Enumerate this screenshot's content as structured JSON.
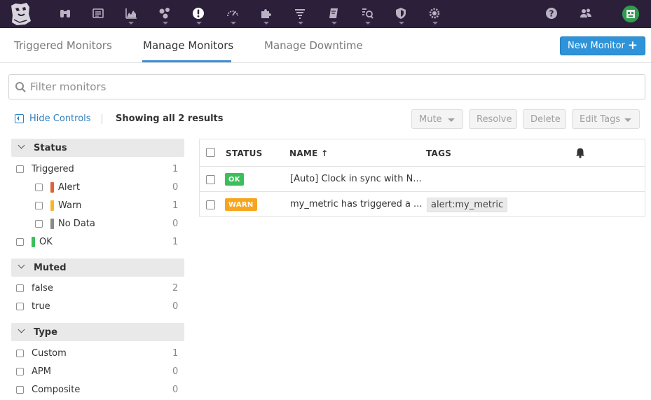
{
  "nav": {
    "icons": [
      "datadog-logo",
      "binoculars-icon",
      "list-icon",
      "area-chart-icon",
      "molecule-icon",
      "alert-icon",
      "dashboard-gauge-icon",
      "puzzle-icon",
      "filter-lines-icon",
      "notebook-icon",
      "apm-icon",
      "shield-icon",
      "gear-icon",
      "help-icon",
      "team-icon",
      "avatar"
    ]
  },
  "tabs": {
    "triggered": "Triggered Monitors",
    "manage": "Manage Monitors",
    "downtime": "Manage Downtime",
    "new_monitor": "New Monitor",
    "new_monitor_plus": "+"
  },
  "filter": {
    "placeholder": "Filter monitors"
  },
  "controls": {
    "hide_controls": "Hide Controls",
    "showing": "Showing all 2 results",
    "mute": "Mute",
    "resolve": "Resolve",
    "delete": "Delete",
    "edit_tags": "Edit Tags"
  },
  "sidebar": {
    "status": {
      "title": "Status",
      "triggered": {
        "label": "Triggered",
        "count": "1"
      },
      "alert": {
        "label": "Alert",
        "count": "0",
        "color": "#e0623a"
      },
      "warn": {
        "label": "Warn",
        "count": "1",
        "color": "#f7b52c"
      },
      "nodata": {
        "label": "No Data",
        "count": "0",
        "color": "#8a8a8a"
      },
      "ok": {
        "label": "OK",
        "count": "1",
        "color": "#3bbf5b"
      }
    },
    "muted": {
      "title": "Muted",
      "false": {
        "label": "false",
        "count": "2"
      },
      "true": {
        "label": "true",
        "count": "0"
      }
    },
    "type": {
      "title": "Type",
      "custom": {
        "label": "Custom",
        "count": "1"
      },
      "apm": {
        "label": "APM",
        "count": "0"
      },
      "composite": {
        "label": "Composite",
        "count": "0"
      }
    }
  },
  "table": {
    "headers": {
      "status": "STATUS",
      "name": "NAME ↑",
      "tags": "TAGS"
    },
    "rows": [
      {
        "status": "OK",
        "status_color": "#3bbf5b",
        "name": "[Auto] Clock in sync with N...",
        "tag": ""
      },
      {
        "status": "WARN",
        "status_color": "#f7a51f",
        "name": "my_metric has triggered a ...",
        "tag": "alert:my_metric"
      }
    ]
  }
}
